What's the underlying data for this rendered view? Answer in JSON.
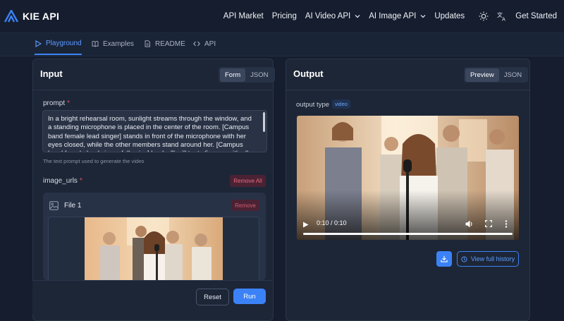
{
  "app": {
    "name": "KIE API"
  },
  "nav": {
    "items": [
      {
        "label": "API Market"
      },
      {
        "label": "Pricing"
      },
      {
        "label": "AI Video API"
      },
      {
        "label": "AI Image API"
      },
      {
        "label": "Updates"
      }
    ],
    "get_started": "Get Started"
  },
  "tabs": [
    {
      "label": "Playground",
      "active": true
    },
    {
      "label": "Examples"
    },
    {
      "label": "README"
    },
    {
      "label": "API"
    }
  ],
  "input": {
    "title": "Input",
    "view_toggle": [
      "Form",
      "JSON"
    ],
    "prompt": {
      "label": "prompt",
      "required_mark": "*",
      "value": "In a bright rehearsal room, sunlight streams through the window, and a standing microphone is placed in the center of the room. [Campus band female lead singer] stands in front of the microphone with her eyes closed, while the other members stand around her. [Campus band female lead singer full voice] leads: \"I will try to fix you, with all my heart and soul...\" The",
      "help": "The text prompt used to generate the video"
    },
    "image_urls": {
      "label": "image_urls",
      "required_mark": "*",
      "remove_all": "Remove All",
      "file": {
        "title": "File 1",
        "remove": "Remove"
      }
    },
    "reset": "Reset",
    "run": "Run"
  },
  "output": {
    "title": "Output",
    "view_toggle": [
      "Preview",
      "JSON"
    ],
    "type_label": "output type",
    "type_value": "video",
    "video": {
      "time": "0:10 / 0:10",
      "progress": 1.0
    },
    "view_history": "View full history"
  },
  "colors": {
    "accent": "#3b82f6",
    "danger": "#e04f63",
    "background": "#151d2e"
  }
}
